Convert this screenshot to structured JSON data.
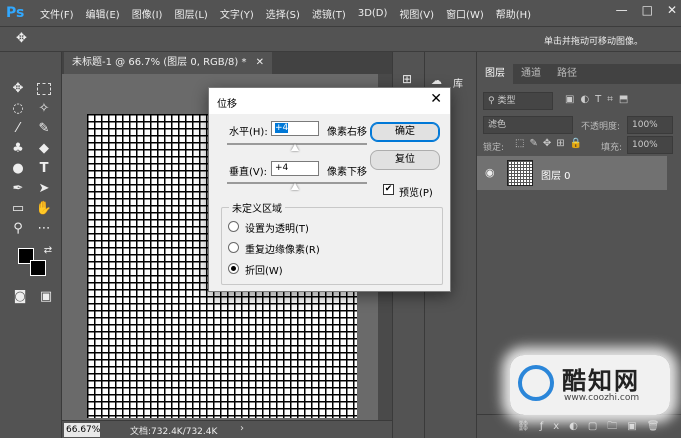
{
  "app": {
    "logo": "Ps"
  },
  "menu": [
    "文件(F)",
    "编辑(E)",
    "图像(I)",
    "图层(L)",
    "文字(Y)",
    "选择(S)",
    "滤镜(T)",
    "3D(D)",
    "视图(V)",
    "窗口(W)",
    "帮助(H)"
  ],
  "window_controls": {
    "minimize": "—",
    "maximize": "□",
    "close": "✕"
  },
  "options_bar": {
    "tool_icon": "✥",
    "hint": "单击并拖动可移动图像。"
  },
  "document": {
    "tab_title": "未标题-1 @ 66.7% (图层 0, RGB/8) *",
    "tab_close": "✕",
    "zoom": "66.67%",
    "doc_info": "文档:732.4K/732.4K"
  },
  "library_panel": {
    "tab": "库"
  },
  "layers_panel": {
    "tabs": [
      "图层",
      "通道",
      "路径"
    ],
    "active_tab": "图层",
    "filter_label": "类型",
    "blend_mode": "滤色",
    "opacity_label": "不透明度:",
    "opacity_value": "100%",
    "lock_label": "锁定:",
    "fill_label": "填充:",
    "fill_value": "100%",
    "layer_name": "图层 0"
  },
  "dialog": {
    "title": "位移",
    "horizontal_label": "水平(H):",
    "horizontal_value": "+4",
    "horizontal_unit": "像素右移",
    "vertical_label": "垂直(V):",
    "vertical_value": "+4",
    "vertical_unit": "像素下移",
    "ok_label": "确定",
    "reset_label": "复位",
    "preview_label": "预览(P)",
    "preview_checked": true,
    "undefined_area_label": "未定义区域",
    "options": [
      {
        "label": "设置为透明(T)",
        "selected": false
      },
      {
        "label": "重复边缘像素(R)",
        "selected": false
      },
      {
        "label": "折回(W)",
        "selected": true
      }
    ]
  },
  "watermark": {
    "brand": "酷知网",
    "url": "www.coozhi.com"
  },
  "colors": {
    "accent": "#31a8ff",
    "selection": "#0078d7",
    "canvas_bg": "#6a6a6a",
    "ui_bg": "#535353"
  }
}
